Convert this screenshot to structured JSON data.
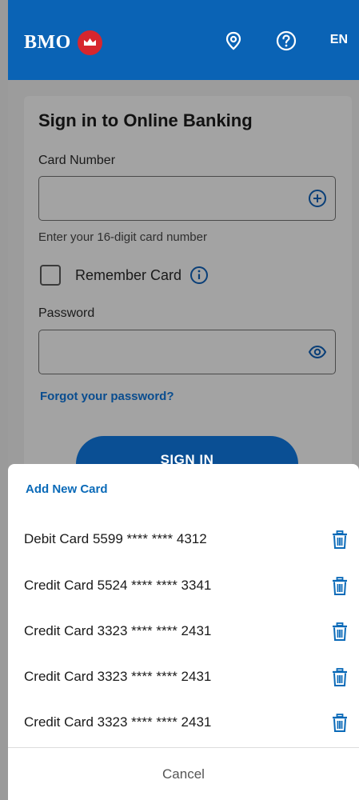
{
  "header": {
    "brand": "BMO",
    "logo_icon": "bmo-roundel-icon",
    "location_icon": "location-pin-icon",
    "help_icon": "help-circle-icon",
    "language": "EN",
    "color": "#0a63b5"
  },
  "login": {
    "title": "Sign in to Online Banking",
    "card_number_label": "Card Number",
    "card_number_value": "",
    "card_add_icon": "plus-circle-icon",
    "card_hint": "Enter your 16-digit card number",
    "remember_label": "Remember Card",
    "remember_checked": false,
    "info_icon": "info-icon",
    "password_label": "Password",
    "password_value": "",
    "password_toggle_icon": "eye-icon",
    "forgot_link": "Forgot your password?",
    "sign_in_button": "SIGN IN"
  },
  "card_sheet": {
    "add_new": "Add New Card",
    "cards": [
      {
        "label": "Debit Card 5599 **** **** 4312"
      },
      {
        "label": "Credit Card 5524 **** **** 3341"
      },
      {
        "label": "Credit Card 3323 **** **** 2431"
      },
      {
        "label": "Credit Card 3323 **** **** 2431"
      },
      {
        "label": "Credit Card 3323 **** **** 2431"
      }
    ],
    "delete_icon": "trash-icon",
    "cancel": "Cancel",
    "accent": "#0a6ab8"
  }
}
